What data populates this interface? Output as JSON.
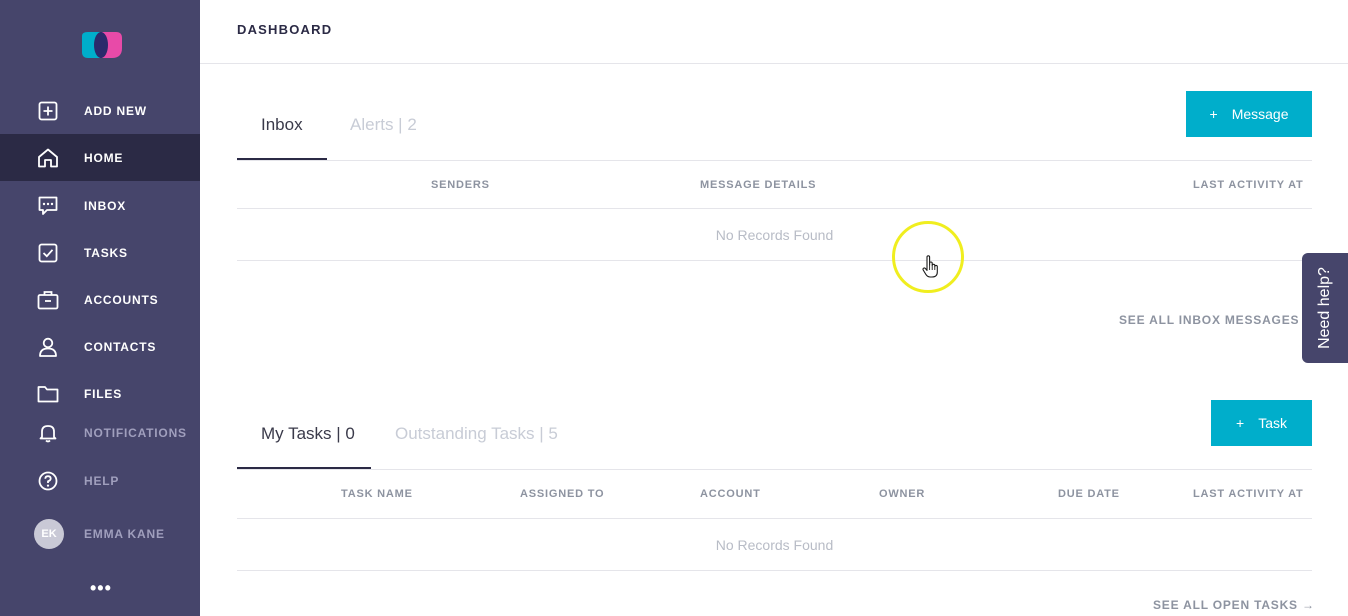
{
  "sidebar": {
    "items": [
      {
        "label": "ADD NEW",
        "icon": "plus-square-icon"
      },
      {
        "label": "HOME",
        "icon": "home-icon"
      },
      {
        "label": "INBOX",
        "icon": "chat-icon"
      },
      {
        "label": "TASKS",
        "icon": "checkbox-icon"
      },
      {
        "label": "ACCOUNTS",
        "icon": "briefcase-icon"
      },
      {
        "label": "CONTACTS",
        "icon": "person-icon"
      },
      {
        "label": "FILES",
        "icon": "folder-icon"
      },
      {
        "label": "NOTIFICATIONS",
        "icon": "bell-icon"
      },
      {
        "label": "HELP",
        "icon": "question-icon"
      }
    ],
    "user": {
      "initials": "EK",
      "name": "EMMA KANE"
    },
    "more": "•••"
  },
  "header": {
    "title": "DASHBOARD"
  },
  "inbox_panel": {
    "tabs": [
      {
        "label": "Inbox",
        "active": true
      },
      {
        "label": "Alerts | 2",
        "active": false
      }
    ],
    "button_label": "Message",
    "button_plus": "+",
    "columns": [
      "SENDERS",
      "MESSAGE DETAILS",
      "LAST ACTIVITY AT"
    ],
    "empty_text": "No Records Found",
    "see_all": "SEE ALL INBOX MESSAGES"
  },
  "tasks_panel": {
    "tabs": [
      {
        "label": "My Tasks | 0",
        "active": true
      },
      {
        "label": "Outstanding Tasks | 5",
        "active": false
      }
    ],
    "button_label": "Task",
    "button_plus": "+",
    "columns": [
      "TASK NAME",
      "ASSIGNED TO",
      "ACCOUNT",
      "OWNER",
      "DUE DATE",
      "LAST ACTIVITY AT"
    ],
    "empty_text": "No Records Found",
    "see_all": "SEE ALL OPEN TASKS →"
  },
  "need_help": "Need help?",
  "colors": {
    "sidebar": "#46456b",
    "sidebar_active": "#2b2a45",
    "accent": "#00aecb",
    "cursor_highlight": "#f0ee1f"
  }
}
